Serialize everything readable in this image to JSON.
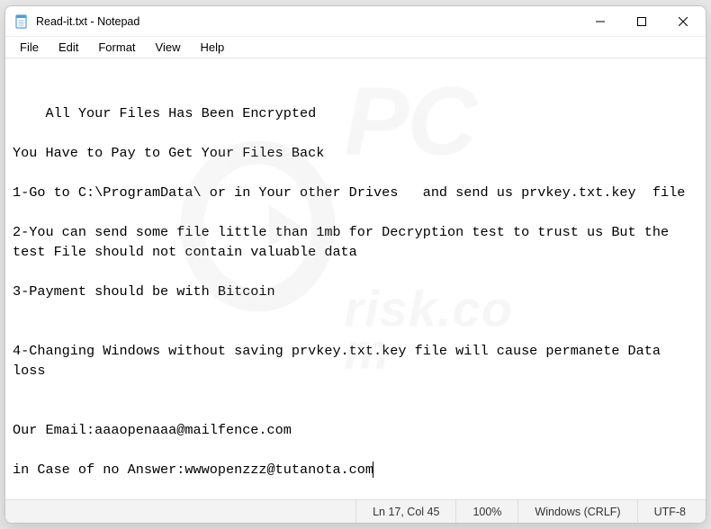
{
  "titlebar": {
    "title": "Read-it.txt - Notepad"
  },
  "menubar": {
    "items": [
      "File",
      "Edit",
      "Format",
      "View",
      "Help"
    ]
  },
  "content": {
    "text": "All Your Files Has Been Encrypted\n\nYou Have to Pay to Get Your Files Back\n\n1-Go to C:\\ProgramData\\ or in Your other Drives   and send us prvkey.txt.key  file\n\n2-You can send some file little than 1mb for Decryption test to trust us But the test File should not contain valuable data\n\n3-Payment should be with Bitcoin\n\n\n4-Changing Windows without saving prvkey.txt.key file will cause permanete Data loss\n\n\nOur Email:aaaopenaaa@mailfence.com\n\nin Case of no Answer:wwwopenzzz@tutanota.com"
  },
  "statusbar": {
    "position": "Ln 17, Col 45",
    "zoom": "100%",
    "line_ending": "Windows (CRLF)",
    "encoding": "UTF-8"
  },
  "watermark": {
    "line1": "PC",
    "line2": "risk.com"
  }
}
